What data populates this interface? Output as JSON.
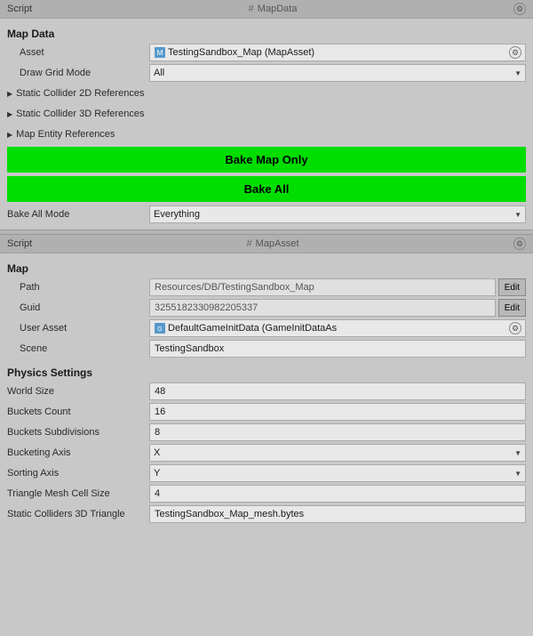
{
  "top_section": {
    "script_label": "Script",
    "script_value": "MapData",
    "gear_icon": "gear-icon",
    "map_data_title": "Map Data",
    "fields": {
      "asset_label": "Asset",
      "asset_value": "TestingSandbox_Map (MapAsset)",
      "draw_grid_mode_label": "Draw Grid Mode",
      "draw_grid_mode_value": "All",
      "static_collider_2d_label": "Static Collider 2D References",
      "static_collider_3d_label": "Static Collider 3D References",
      "map_entity_label": "Map Entity References"
    },
    "buttons": {
      "bake_map_only": "Bake Map Only",
      "bake_all": "Bake All"
    },
    "bake_all_mode_label": "Bake All Mode",
    "bake_all_mode_value": "Everything"
  },
  "bottom_section": {
    "script_label": "Script",
    "script_value": "MapAsset",
    "map_title": "Map",
    "path_label": "Path",
    "path_value": "Resources/DB/TestingSandbox_Map",
    "edit_label": "Edit",
    "guid_label": "Guid",
    "guid_value": "3255182330982205337",
    "user_asset_label": "User Asset",
    "user_asset_value": "DefaultGameInitData (GameInitDataAs",
    "scene_label": "Scene",
    "scene_value": "TestingSandbox",
    "physics_title": "Physics Settings",
    "world_size_label": "World Size",
    "world_size_value": "48",
    "buckets_count_label": "Buckets Count",
    "buckets_count_value": "16",
    "buckets_subdivisions_label": "Buckets Subdivisions",
    "buckets_subdivisions_value": "8",
    "bucketing_axis_label": "Bucketing Axis",
    "bucketing_axis_value": "X",
    "sorting_axis_label": "Sorting Axis",
    "sorting_axis_value": "Y",
    "triangle_mesh_cell_size_label": "Triangle Mesh Cell Size",
    "triangle_mesh_cell_size_value": "4",
    "static_colliders_3d_label": "Static Colliders 3D Triangle",
    "static_colliders_3d_value": "TestingSandbox_Map_mesh.bytes"
  }
}
